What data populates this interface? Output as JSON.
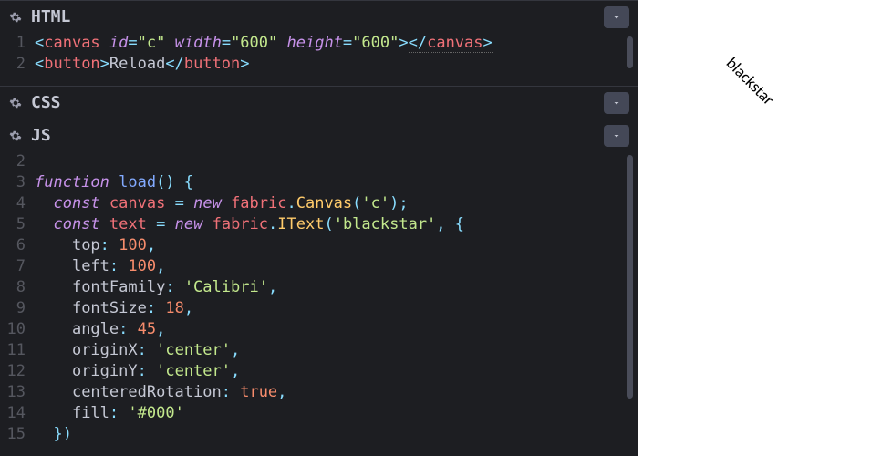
{
  "panels": {
    "html": {
      "title": "HTML"
    },
    "css": {
      "title": "CSS"
    },
    "js": {
      "title": "JS"
    }
  },
  "html_lines": [
    "1",
    "2"
  ],
  "html_code": {
    "l1_tag": "canvas",
    "l1_a1": "id",
    "l1_v1": "\"c\"",
    "l1_a2": "width",
    "l1_v2": "\"600\"",
    "l1_a3": "height",
    "l1_v3": "\"600\"",
    "l1_close": "canvas",
    "l2_tag": "button",
    "l2_text": "Reload",
    "l2_close": "button"
  },
  "js_lines": [
    "2",
    "3",
    "4",
    "5",
    "6",
    "7",
    "8",
    "9",
    "10",
    "11",
    "12",
    "13",
    "14",
    "15"
  ],
  "js": {
    "fn_kw": "function",
    "fn_name": "load",
    "const1": "const",
    "canvas_var": "canvas",
    "new1": "new",
    "fabric": "fabric",
    "Canvas": "Canvas",
    "c_str": "'c'",
    "const2": "const",
    "text_var": "text",
    "new2": "new",
    "IText": "IText",
    "blackstar": "'blackstar'",
    "top": "top",
    "top_v": "100",
    "left": "left",
    "left_v": "100",
    "fontFamily": "fontFamily",
    "fontFamily_v": "'Calibri'",
    "fontSize": "fontSize",
    "fontSize_v": "18",
    "angle": "angle",
    "angle_v": "45",
    "originX": "originX",
    "originX_v": "'center'",
    "originY": "originY",
    "originY_v": "'center'",
    "centeredRotation": "centeredRotation",
    "centeredRotation_v": "true",
    "fill": "fill",
    "fill_v": "'#000'"
  },
  "preview": {
    "text": "blackstar"
  },
  "chart_data": {
    "type": "table",
    "title": "fabric.IText properties",
    "properties": [
      {
        "key": "top",
        "value": 100
      },
      {
        "key": "left",
        "value": 100
      },
      {
        "key": "fontFamily",
        "value": "Calibri"
      },
      {
        "key": "fontSize",
        "value": 18
      },
      {
        "key": "angle",
        "value": 45
      },
      {
        "key": "originX",
        "value": "center"
      },
      {
        "key": "originY",
        "value": "center"
      },
      {
        "key": "centeredRotation",
        "value": true
      },
      {
        "key": "fill",
        "value": "#000"
      }
    ]
  }
}
